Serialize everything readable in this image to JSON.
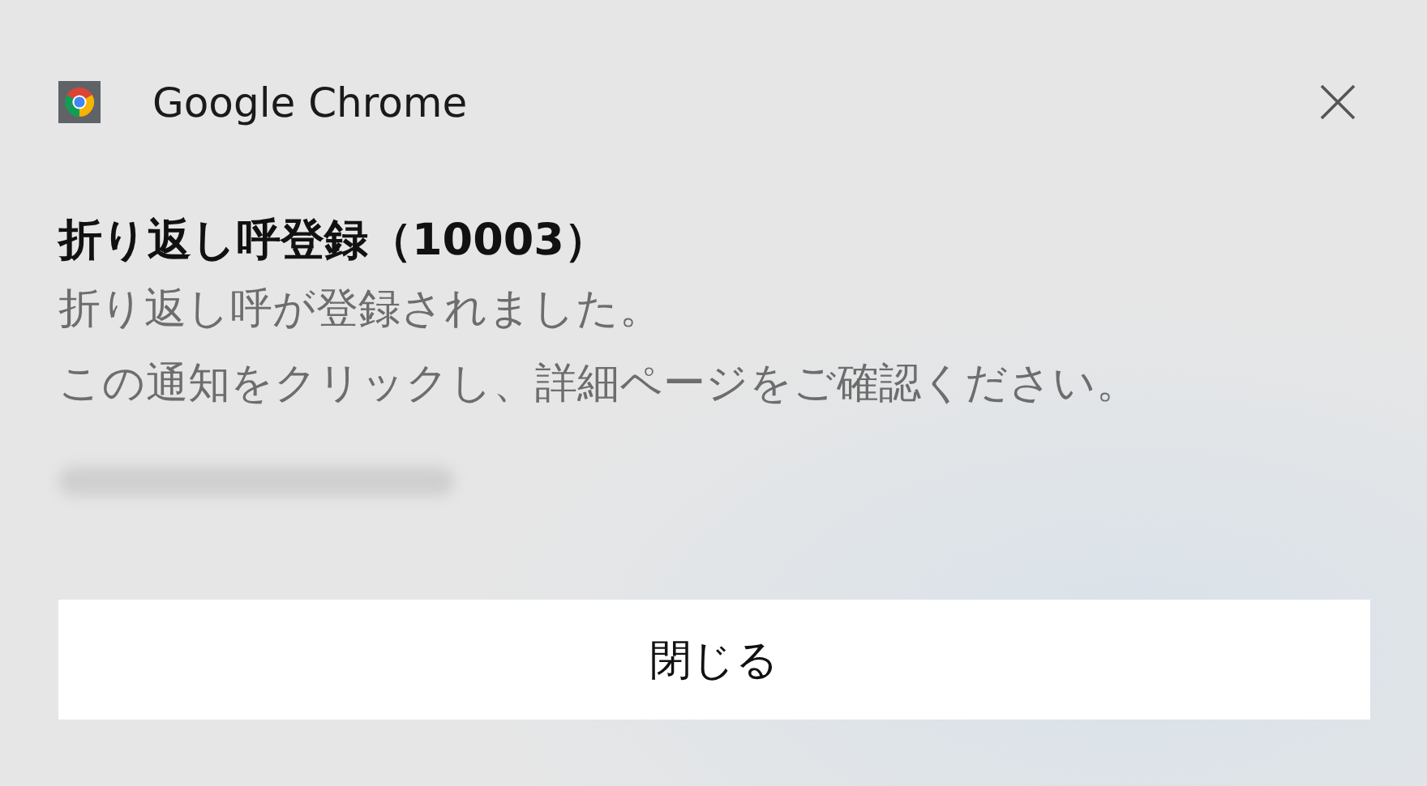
{
  "app": {
    "name": "Google Chrome"
  },
  "notification": {
    "title": "折り返し呼登録（10003）",
    "lines": [
      "折り返し呼が登録されました。",
      "この通知をクリックし、詳細ページをご確認ください。"
    ]
  },
  "buttons": [
    "閉じる"
  ]
}
